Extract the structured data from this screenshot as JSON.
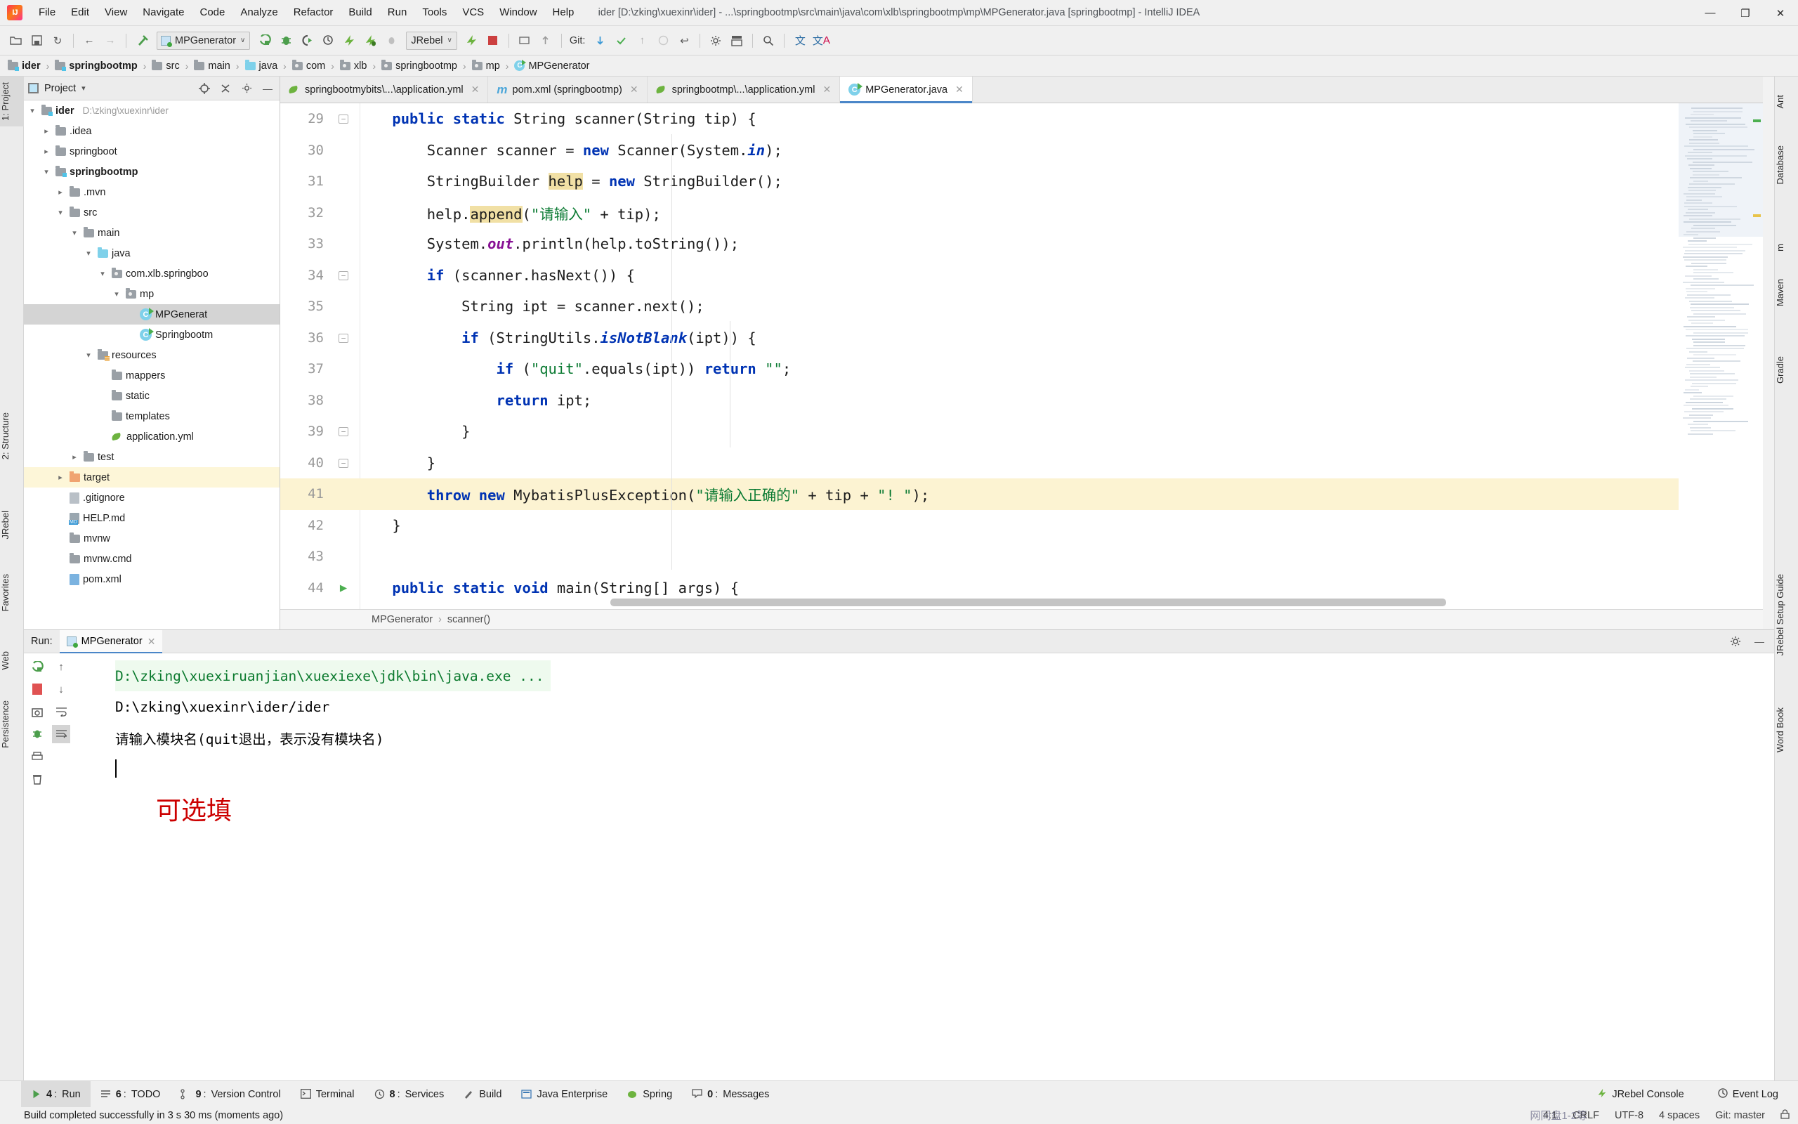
{
  "window": {
    "title": "ider [D:\\zking\\xuexinr\\ider] - ...\\springbootmp\\src\\main\\java\\com\\xlb\\springbootmp\\mp\\MPGenerator.java [springbootmp] - IntelliJ IDEA",
    "minimize": "—",
    "maximize": "❐",
    "close": "✕"
  },
  "menu": [
    "File",
    "Edit",
    "View",
    "Navigate",
    "Code",
    "Analyze",
    "Refactor",
    "Build",
    "Run",
    "Tools",
    "VCS",
    "Window",
    "Help"
  ],
  "toolbar": {
    "run_config": "MPGenerator",
    "caret": "∨",
    "jrebel": "JRebel",
    "jrebel_caret": "∨",
    "git_label": "Git:",
    "icons": [
      "open-folder-icon",
      "save-all-icon",
      "sync-icon",
      "back-arrow-icon",
      "forward-arrow-icon",
      "build-hammer-icon",
      "run-icon",
      "debug-icon",
      "run-with-coverage-icon",
      "profile-icon",
      "jrebel-run-icon",
      "jrebel-debug-icon",
      "attach-icon",
      "stop-icon",
      "stop-square-icon",
      "update-project-icon",
      "commit-icon",
      "git-update-icon",
      "git-commit-icon",
      "git-push-icon",
      "git-history-icon",
      "git-revert-icon",
      "settings-icon",
      "project-structure-icon",
      "search-everywhere-icon",
      "translate-icon",
      "lang-icon"
    ]
  },
  "breadcrumb": [
    {
      "label": "ider",
      "icon": "module-folder-icon",
      "bold": true,
      "kind": "mod"
    },
    {
      "label": "springbootmp",
      "icon": "module-folder-icon",
      "bold": true,
      "kind": "mod"
    },
    {
      "label": "src",
      "icon": "folder-icon",
      "bold": false,
      "kind": "gray"
    },
    {
      "label": "main",
      "icon": "folder-icon",
      "bold": false,
      "kind": "gray"
    },
    {
      "label": "java",
      "icon": "source-folder-icon",
      "bold": false,
      "kind": "blue"
    },
    {
      "label": "com",
      "icon": "package-icon",
      "bold": false,
      "kind": "pkg"
    },
    {
      "label": "xlb",
      "icon": "package-icon",
      "bold": false,
      "kind": "pkg"
    },
    {
      "label": "springbootmp",
      "icon": "package-icon",
      "bold": false,
      "kind": "pkg"
    },
    {
      "label": "mp",
      "icon": "package-icon",
      "bold": false,
      "kind": "pkg"
    },
    {
      "label": "MPGenerator",
      "icon": "java-class-icon",
      "bold": false,
      "kind": "class"
    }
  ],
  "left_strip": [
    {
      "label": "1: Project",
      "selected": true
    },
    {
      "label": "2: Structure",
      "selected": false
    },
    {
      "label": "JRebel",
      "selected": false
    },
    {
      "label": "Favorites",
      "selected": false
    },
    {
      "label": "Web",
      "selected": false
    },
    {
      "label": "Persistence",
      "selected": false
    }
  ],
  "right_strip": [
    {
      "label": "Ant"
    },
    {
      "label": "Database"
    },
    {
      "label": "m"
    },
    {
      "label": "Maven"
    },
    {
      "label": "Gradle"
    },
    {
      "label": "JRebel Setup Guide"
    },
    {
      "label": "Word Book"
    }
  ],
  "project_panel": {
    "title": "Project",
    "title_caret": "▾",
    "head_icons": [
      "locate-icon",
      "collapse-all-icon",
      "settings-icon",
      "hide-icon"
    ],
    "tree": [
      {
        "indent": 0,
        "arrow": "down",
        "icon": "module-folder-icon",
        "label": "ider",
        "bold": true,
        "path": "D:\\zking\\xuexinr\\ider",
        "state": "normal"
      },
      {
        "indent": 1,
        "arrow": "right",
        "icon": "folder-icon",
        "label": ".idea",
        "bold": false,
        "path": "",
        "state": "normal"
      },
      {
        "indent": 1,
        "arrow": "right",
        "icon": "folder-icon",
        "label": "springboot",
        "bold": false,
        "path": "",
        "state": "normal"
      },
      {
        "indent": 1,
        "arrow": "down",
        "icon": "module-folder-icon",
        "label": "springbootmp",
        "bold": true,
        "path": "",
        "state": "normal"
      },
      {
        "indent": 2,
        "arrow": "right",
        "icon": "folder-icon",
        "label": ".mvn",
        "bold": false,
        "path": "",
        "state": "normal"
      },
      {
        "indent": 2,
        "arrow": "down",
        "icon": "folder-icon",
        "label": "src",
        "bold": false,
        "path": "",
        "state": "normal"
      },
      {
        "indent": 3,
        "arrow": "down",
        "icon": "folder-icon",
        "label": "main",
        "bold": false,
        "path": "",
        "state": "normal"
      },
      {
        "indent": 4,
        "arrow": "down",
        "icon": "source-folder-icon",
        "label": "java",
        "bold": false,
        "path": "",
        "state": "normal"
      },
      {
        "indent": 5,
        "arrow": "down",
        "icon": "package-icon",
        "label": "com.xlb.springboo",
        "bold": false,
        "path": "",
        "state": "normal"
      },
      {
        "indent": 6,
        "arrow": "down",
        "icon": "package-icon",
        "label": "mp",
        "bold": false,
        "path": "",
        "state": "normal"
      },
      {
        "indent": 7,
        "arrow": "none",
        "icon": "java-class-icon",
        "label": "MPGenerat",
        "bold": false,
        "path": "",
        "state": "selected"
      },
      {
        "indent": 7,
        "arrow": "none",
        "icon": "java-class-icon",
        "label": "Springbootm",
        "bold": false,
        "path": "",
        "state": "normal"
      },
      {
        "indent": 4,
        "arrow": "down",
        "icon": "resource-folder-icon",
        "label": "resources",
        "bold": false,
        "path": "",
        "state": "normal"
      },
      {
        "indent": 5,
        "arrow": "none",
        "icon": "folder-icon",
        "label": "mappers",
        "bold": false,
        "path": "",
        "state": "normal"
      },
      {
        "indent": 5,
        "arrow": "none",
        "icon": "folder-icon",
        "label": "static",
        "bold": false,
        "path": "",
        "state": "normal"
      },
      {
        "indent": 5,
        "arrow": "none",
        "icon": "folder-icon",
        "label": "templates",
        "bold": false,
        "path": "",
        "state": "normal"
      },
      {
        "indent": 5,
        "arrow": "none",
        "icon": "spring-yaml-icon",
        "label": "application.yml",
        "bold": false,
        "path": "",
        "state": "normal"
      },
      {
        "indent": 3,
        "arrow": "right",
        "icon": "folder-icon",
        "label": "test",
        "bold": false,
        "path": "",
        "state": "normal"
      },
      {
        "indent": 2,
        "arrow": "right",
        "icon": "target-folder-icon",
        "label": "target",
        "bold": false,
        "path": "",
        "state": "highlight"
      },
      {
        "indent": 2,
        "arrow": "none",
        "icon": "gitignore-icon",
        "label": ".gitignore",
        "bold": false,
        "path": "",
        "state": "normal"
      },
      {
        "indent": 2,
        "arrow": "none",
        "icon": "markdown-icon",
        "label": "HELP.md",
        "bold": false,
        "path": "",
        "state": "normal"
      },
      {
        "indent": 2,
        "arrow": "none",
        "icon": "file-icon",
        "label": "mvnw",
        "bold": false,
        "path": "",
        "state": "normal"
      },
      {
        "indent": 2,
        "arrow": "none",
        "icon": "file-icon",
        "label": "mvnw.cmd",
        "bold": false,
        "path": "",
        "state": "normal"
      },
      {
        "indent": 2,
        "arrow": "none",
        "icon": "maven-xml-icon",
        "label": "pom.xml",
        "bold": false,
        "path": "",
        "state": "normal"
      }
    ]
  },
  "editor_tabs": [
    {
      "label": "springbootmybits\\...\\application.yml",
      "icon": "spring-yaml-icon",
      "active": false,
      "close": "✕"
    },
    {
      "label": "pom.xml (springbootmp)",
      "icon": "maven-icon",
      "active": false,
      "close": "✕"
    },
    {
      "label": "springbootmp\\...\\application.yml",
      "icon": "spring-yaml-icon",
      "active": false,
      "close": "✕"
    },
    {
      "label": "MPGenerator.java",
      "icon": "java-class-icon",
      "active": true,
      "close": "✕"
    }
  ],
  "code": {
    "lines": [
      {
        "num": "29",
        "fold": "minus",
        "highlight": false,
        "html": "    <span class=\"kw\">public static</span> String scanner(String tip) {"
      },
      {
        "num": "30",
        "fold": "",
        "highlight": false,
        "html": "        Scanner scanner = <span class=\"kw\">new</span> Scanner(System.<span class=\"kw2\">in</span>);"
      },
      {
        "num": "31",
        "fold": "",
        "highlight": false,
        "html": "        StringBuilder <span class=\"hi\">help</span> = <span class=\"kw\">new</span> StringBuilder();"
      },
      {
        "num": "32",
        "fold": "",
        "highlight": false,
        "html": "        help.<span class=\"hi\">append</span>(<span class=\"str\">\"请输入\"</span> + tip);"
      },
      {
        "num": "33",
        "fold": "",
        "highlight": false,
        "html": "        System.<span class=\"fld\">out</span>.println(help.toString());"
      },
      {
        "num": "34",
        "fold": "minus",
        "highlight": false,
        "html": "        <span class=\"kw\">if</span> (scanner.hasNext()) {"
      },
      {
        "num": "35",
        "fold": "",
        "highlight": false,
        "html": "            String ipt = scanner.next();"
      },
      {
        "num": "36",
        "fold": "minus",
        "highlight": false,
        "html": "            <span class=\"kw\">if</span> (StringUtils.<span class=\"kw2\">isNotBlank</span>(ipt)) {"
      },
      {
        "num": "37",
        "fold": "",
        "highlight": false,
        "html": "                <span class=\"kw\">if</span> (<span class=\"str\">\"quit\"</span>.equals(ipt)) <span class=\"kw\">return</span> <span class=\"str\">\"\"</span>;"
      },
      {
        "num": "38",
        "fold": "",
        "highlight": false,
        "html": "                <span class=\"kw\">return</span> ipt;"
      },
      {
        "num": "39",
        "fold": "minus",
        "highlight": false,
        "html": "            }"
      },
      {
        "num": "40",
        "fold": "minus",
        "highlight": false,
        "html": "        }"
      },
      {
        "num": "41",
        "fold": "",
        "highlight": true,
        "html": "        <span class=\"kw\">throw new</span> MybatisPlusException(<span class=\"str\">\"请输入正确的\"</span> + tip + <span class=\"str\">\"! \"</span>);"
      },
      {
        "num": "42",
        "fold": "",
        "highlight": false,
        "html": "    }"
      },
      {
        "num": "43",
        "fold": "",
        "highlight": false,
        "html": ""
      },
      {
        "num": "44",
        "fold": "run",
        "highlight": false,
        "html": "    <span class=\"kw\">public static void</span> main(String[] args) {"
      }
    ]
  },
  "editor_breadcrumb": {
    "class": "MPGenerator",
    "sep": "›",
    "method": "scanner()"
  },
  "run_panel": {
    "label": "Run:",
    "tab": "MPGenerator",
    "tab_close": "✕",
    "settings_icon": "gear-icon",
    "hide_icon": "minimize-icon",
    "actions": [
      "rerun-icon",
      "stop-icon",
      "screenshot-icon",
      "print-icon",
      "thread-dump-icon",
      "export-icon",
      "soft-wrap-icon",
      "scroll-end-icon",
      "clear-all-icon"
    ],
    "console": [
      {
        "text": "D:\\zking\\xuexiruanjian\\xuexiexe\\jdk\\bin\\java.exe ...",
        "style": "green"
      },
      {
        "text": "D:\\zking\\xuexinr\\ider/ider",
        "style": "plain"
      },
      {
        "text": "请输入模块名(quit退出，表示没有模块名)",
        "style": "plain"
      },
      {
        "text": "",
        "style": "cursor"
      },
      {
        "text": "可选填",
        "style": "annotation-red"
      }
    ]
  },
  "bottom_tabs": [
    {
      "num": "4",
      "label": "Run",
      "icon": "run-icon",
      "selected": true
    },
    {
      "num": "6",
      "label": "TODO",
      "icon": "todo-icon",
      "selected": false
    },
    {
      "num": "9",
      "label": "Version Control",
      "icon": "vcs-icon",
      "selected": false
    },
    {
      "num": "",
      "label": "Terminal",
      "icon": "terminal-icon",
      "selected": false
    },
    {
      "num": "8",
      "label": "Services",
      "icon": "services-icon",
      "selected": false
    },
    {
      "num": "",
      "label": "Build",
      "icon": "build-icon",
      "selected": false
    },
    {
      "num": "",
      "label": "Java Enterprise",
      "icon": "jee-icon",
      "selected": false
    },
    {
      "num": "",
      "label": "Spring",
      "icon": "spring-icon",
      "selected": false
    },
    {
      "num": "0",
      "label": "Messages",
      "icon": "messages-icon",
      "selected": false
    }
  ],
  "bottom_right": [
    {
      "label": "JRebel Console",
      "icon": "jrebel-icon"
    },
    {
      "label": "Event Log",
      "icon": "event-log-icon"
    }
  ],
  "status": {
    "message": "Build completed successfully in 3 s 30 ms (moments ago)",
    "caret_pos": "4:1",
    "line_sep": "CRLF",
    "encoding": "UTF-8",
    "indent": "4 spaces",
    "branch": "Git: master",
    "lock_icon": "lock-icon",
    "watermark": "网同盘1-2等"
  },
  "colors": {
    "accent": "#4a86c8",
    "keyword": "#0033b3",
    "string": "#0a7a32",
    "field": "#871094",
    "highlight_line": "#fcf3d2",
    "search_highlight": "#f1e0a5",
    "console_green": "#0b7a2e",
    "annotation_red": "#cc0000",
    "selected_row": "#d4d4d4",
    "target_row": "#fdf6d8"
  }
}
